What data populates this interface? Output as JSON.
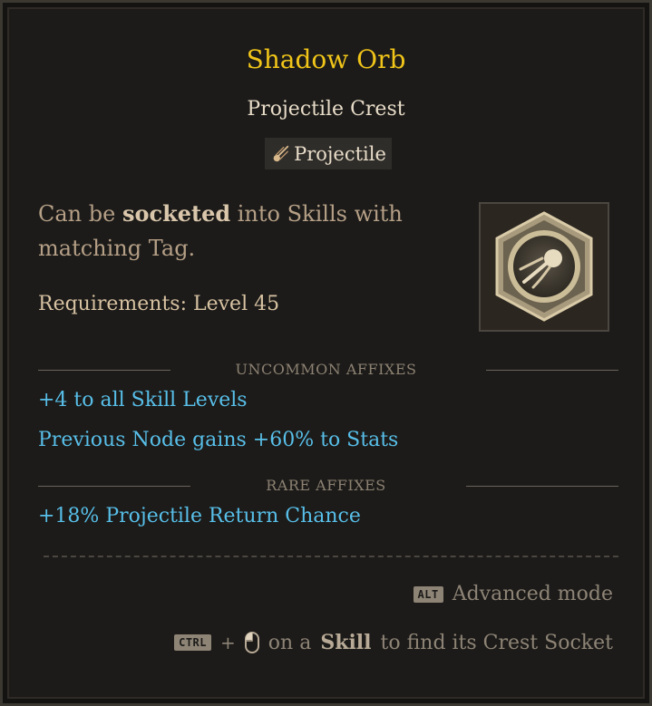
{
  "item": {
    "name": "Shadow Orb",
    "type": "Projectile Crest",
    "tag": "Projectile",
    "tag_icon": "comet-icon",
    "description_pre": "Can be ",
    "description_bold": "socketed",
    "description_post": " into Skills with matching Tag.",
    "requirements": "Requirements: Level 45"
  },
  "sections": {
    "uncommon_label": "UNCOMMON AFFIXES",
    "rare_label": "RARE AFFIXES"
  },
  "uncommon_affixes": [
    "+4 to all Skill Levels",
    "Previous Node gains +60% to Stats"
  ],
  "rare_affixes": [
    "+18% Projectile Return Chance"
  ],
  "hints": {
    "alt_key": "ALT",
    "alt_text": "Advanced mode",
    "ctrl_key": "CTRL",
    "plus": "+",
    "mouse_icon": "mouse-left-click-icon",
    "ctrl_text_pre": "on a",
    "ctrl_text_bold": "Skill",
    "ctrl_text_post": "to find its Crest Socket"
  },
  "colors": {
    "title": "#f0c419",
    "affix": "#58bfe9",
    "background": "#1c1b19"
  }
}
